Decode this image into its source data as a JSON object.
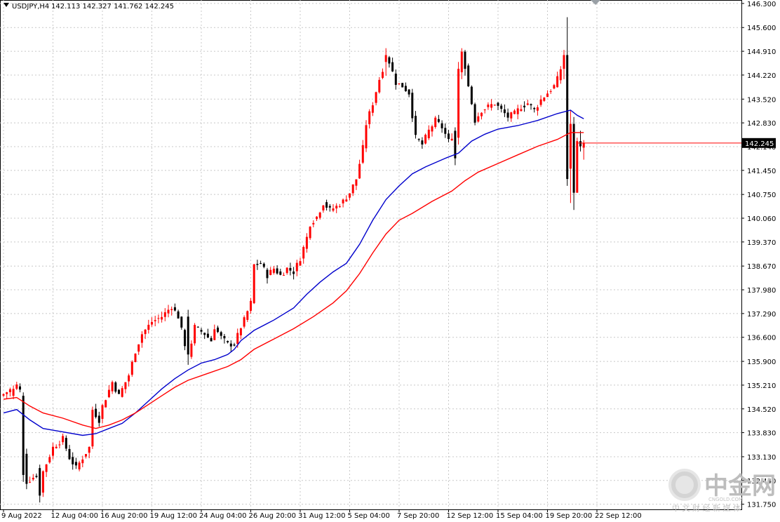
{
  "header": {
    "symbol": "USDJPY,H4",
    "ohlc": "142.113 142.327 141.762 142.245"
  },
  "watermark": {
    "brand": "中金网",
    "site": "CNGOLD.COM",
    "tagline": "中 文 财 经 新 媒 体"
  },
  "chart_data": {
    "type": "candlestick",
    "title": "USDJPY,H4",
    "x_tick_labels": [
      "9 Aug 2022",
      "12 Aug 04:00",
      "16 Aug 20:00",
      "19 Aug 12:00",
      "24 Aug 04:00",
      "26 Aug 20:00",
      "31 Aug 12:00",
      "5 Sep 04:00",
      "7 Sep 20:00",
      "12 Sep 12:00",
      "15 Sep 04:00",
      "19 Sep 20:00",
      "22 Sep 12:00"
    ],
    "x_tick_bar_index": [
      0,
      15,
      30,
      45,
      60,
      75,
      90,
      105,
      120,
      135,
      150,
      165,
      180
    ],
    "y_tick_labels": [
      "146.300",
      "145.600",
      "144.910",
      "144.220",
      "143.520",
      "142.830",
      "142.140",
      "141.450",
      "140.750",
      "140.060",
      "139.370",
      "138.670",
      "137.980",
      "137.290",
      "136.600",
      "135.900",
      "135.210",
      "134.520",
      "133.830",
      "133.130",
      "132.440",
      "131.750"
    ],
    "ylim": [
      131.6,
      146.4
    ],
    "current_price": "142.245",
    "colors": {
      "up": "#ff0000",
      "down": "#000000",
      "ma_fast": "#0000cc",
      "ma_slow": "#ff0000",
      "grid": "#c8c8c8",
      "price_box": "#000000"
    },
    "anchors": [
      [
        0,
        134.95
      ],
      [
        4,
        135.2
      ],
      [
        5,
        135.05
      ],
      [
        6,
        133.25
      ],
      [
        7,
        132.4
      ],
      [
        10,
        132.6
      ],
      [
        11,
        132.1
      ],
      [
        12,
        132.7
      ],
      [
        15,
        133.4
      ],
      [
        18,
        133.65
      ],
      [
        20,
        133.1
      ],
      [
        22,
        132.8
      ],
      [
        26,
        133.4
      ],
      [
        27,
        134.5
      ],
      [
        29,
        134.2
      ],
      [
        30,
        134.6
      ],
      [
        33,
        135.3
      ],
      [
        35,
        134.9
      ],
      [
        38,
        135.5
      ],
      [
        40,
        136.2
      ],
      [
        42,
        136.7
      ],
      [
        45,
        137.05
      ],
      [
        48,
        137.2
      ],
      [
        51,
        137.5
      ],
      [
        53,
        137.2
      ],
      [
        56,
        136.0
      ],
      [
        58,
        136.9
      ],
      [
        61,
        136.7
      ],
      [
        63,
        136.5
      ],
      [
        64,
        136.9
      ],
      [
        66,
        136.6
      ],
      [
        68,
        136.4
      ],
      [
        70,
        136.4
      ],
      [
        72,
        136.9
      ],
      [
        73,
        137.1
      ],
      [
        75,
        137.6
      ],
      [
        76,
        138.7
      ],
      [
        78,
        138.75
      ],
      [
        80,
        138.4
      ],
      [
        82,
        138.6
      ],
      [
        84,
        138.4
      ],
      [
        86,
        138.6
      ],
      [
        88,
        138.5
      ],
      [
        90,
        138.9
      ],
      [
        92,
        139.5
      ],
      [
        93,
        139.9
      ],
      [
        95,
        140.1
      ],
      [
        97,
        140.5
      ],
      [
        99,
        140.3
      ],
      [
        101,
        140.4
      ],
      [
        103,
        140.55
      ],
      [
        105,
        140.8
      ],
      [
        107,
        141.2
      ],
      [
        109,
        142.1
      ],
      [
        110,
        142.8
      ],
      [
        112,
        143.4
      ],
      [
        114,
        144.1
      ],
      [
        116,
        144.7
      ],
      [
        117,
        144.6
      ],
      [
        119,
        144.0
      ],
      [
        121,
        143.9
      ],
      [
        123,
        143.7
      ],
      [
        125,
        142.4
      ],
      [
        127,
        142.2
      ],
      [
        129,
        142.6
      ],
      [
        131,
        142.9
      ],
      [
        133,
        142.7
      ],
      [
        135,
        142.3
      ],
      [
        137,
        142.6
      ],
      [
        138,
        144.3
      ],
      [
        139,
        144.8
      ],
      [
        140,
        144.5
      ],
      [
        141,
        143.9
      ],
      [
        143,
        142.9
      ],
      [
        145,
        143.2
      ],
      [
        147,
        143.3
      ],
      [
        149,
        143.4
      ],
      [
        151,
        143.2
      ],
      [
        153,
        143.0
      ],
      [
        155,
        143.1
      ],
      [
        157,
        143.3
      ],
      [
        159,
        143.4
      ],
      [
        161,
        143.2
      ],
      [
        163,
        143.5
      ],
      [
        165,
        143.7
      ],
      [
        167,
        143.9
      ],
      [
        168,
        144.1
      ],
      [
        169,
        144.4
      ],
      [
        170,
        144.8
      ],
      [
        171,
        144.6
      ],
      [
        172,
        143.5
      ],
      [
        173,
        141.0
      ],
      [
        174,
        140.9
      ],
      [
        175,
        142.1
      ],
      [
        176,
        142.25
      ]
    ],
    "special": {
      "3": [
        134.9,
        135.2,
        134.8,
        135.1
      ],
      "6": [
        134.9,
        135.0,
        132.4,
        132.6
      ],
      "11": [
        132.8,
        132.9,
        131.8,
        132.0
      ],
      "56": [
        137.2,
        137.4,
        135.8,
        136.1
      ],
      "116": [
        144.6,
        145.0,
        144.2,
        144.8
      ],
      "137": [
        142.6,
        142.7,
        141.6,
        141.8
      ],
      "138": [
        142.4,
        144.6,
        142.2,
        144.4
      ],
      "139": [
        144.3,
        145.0,
        144.1,
        144.9
      ],
      "140": [
        144.9,
        144.95,
        144.2,
        144.4
      ],
      "170": [
        144.4,
        144.95,
        144.1,
        144.8
      ],
      "171": [
        144.8,
        145.9,
        141.0,
        141.2
      ],
      "172": [
        141.5,
        143.2,
        140.5,
        142.8
      ],
      "173": [
        142.8,
        143.0,
        140.3,
        140.8
      ],
      "174": [
        140.8,
        142.4,
        140.8,
        142.3
      ],
      "175": [
        142.3,
        142.6,
        142.0,
        142.15
      ],
      "176": [
        142.11,
        142.33,
        141.76,
        142.25
      ]
    },
    "ma_fast": {
      "name": "",
      "points": [
        [
          0,
          134.4
        ],
        [
          4,
          134.5
        ],
        [
          8,
          134.2
        ],
        [
          12,
          133.95
        ],
        [
          18,
          133.85
        ],
        [
          24,
          133.75
        ],
        [
          28,
          133.8
        ],
        [
          32,
          133.95
        ],
        [
          36,
          134.1
        ],
        [
          40,
          134.4
        ],
        [
          44,
          134.75
        ],
        [
          48,
          135.1
        ],
        [
          52,
          135.4
        ],
        [
          56,
          135.65
        ],
        [
          60,
          135.85
        ],
        [
          64,
          135.95
        ],
        [
          68,
          136.1
        ],
        [
          70,
          136.25
        ],
        [
          72,
          136.5
        ],
        [
          76,
          136.8
        ],
        [
          82,
          137.1
        ],
        [
          88,
          137.45
        ],
        [
          92,
          137.85
        ],
        [
          96,
          138.2
        ],
        [
          100,
          138.5
        ],
        [
          104,
          138.75
        ],
        [
          108,
          139.3
        ],
        [
          112,
          140.0
        ],
        [
          116,
          140.6
        ],
        [
          120,
          141.0
        ],
        [
          124,
          141.35
        ],
        [
          128,
          141.55
        ],
        [
          134,
          141.8
        ],
        [
          138,
          141.95
        ],
        [
          142,
          142.3
        ],
        [
          146,
          142.5
        ],
        [
          150,
          142.65
        ],
        [
          156,
          142.75
        ],
        [
          162,
          142.9
        ],
        [
          168,
          143.1
        ],
        [
          172,
          143.2
        ],
        [
          174,
          143.05
        ],
        [
          176,
          142.95
        ]
      ]
    },
    "ma_slow": {
      "name": "",
      "points": [
        [
          0,
          134.8
        ],
        [
          4,
          134.85
        ],
        [
          8,
          134.6
        ],
        [
          12,
          134.4
        ],
        [
          18,
          134.25
        ],
        [
          24,
          134.05
        ],
        [
          28,
          133.95
        ],
        [
          32,
          134.05
        ],
        [
          36,
          134.2
        ],
        [
          40,
          134.4
        ],
        [
          44,
          134.65
        ],
        [
          48,
          134.9
        ],
        [
          52,
          135.15
        ],
        [
          56,
          135.35
        ],
        [
          62,
          135.55
        ],
        [
          68,
          135.75
        ],
        [
          72,
          135.95
        ],
        [
          76,
          136.25
        ],
        [
          82,
          136.55
        ],
        [
          88,
          136.85
        ],
        [
          94,
          137.2
        ],
        [
          100,
          137.6
        ],
        [
          104,
          137.95
        ],
        [
          108,
          138.45
        ],
        [
          112,
          139.05
        ],
        [
          116,
          139.6
        ],
        [
          120,
          140.0
        ],
        [
          124,
          140.2
        ],
        [
          130,
          140.55
        ],
        [
          136,
          140.85
        ],
        [
          140,
          141.15
        ],
        [
          144,
          141.4
        ],
        [
          150,
          141.65
        ],
        [
          156,
          141.9
        ],
        [
          162,
          142.15
        ],
        [
          168,
          142.35
        ],
        [
          172,
          142.55
        ],
        [
          176,
          142.55
        ]
      ]
    }
  }
}
